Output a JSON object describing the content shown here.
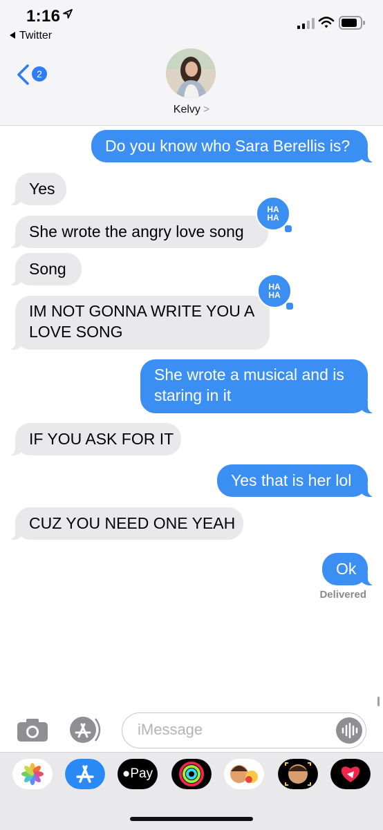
{
  "status_bar": {
    "time": "1:16",
    "back_app": "Twitter"
  },
  "header": {
    "unread_count": "2",
    "contact_name": "Kelvy",
    "chevron": ">"
  },
  "messages": [
    {
      "from": "me",
      "text": "Do you know who Sara Berellis is?"
    },
    {
      "from": "them",
      "text": "Yes"
    },
    {
      "from": "them",
      "text": "She wrote the angry love song",
      "reaction": "HA HA"
    },
    {
      "from": "them",
      "text": "Song"
    },
    {
      "from": "them",
      "text": "IM NOT GONNA WRITE YOU A LOVE SONG",
      "reaction": "HA HA"
    },
    {
      "from": "me",
      "text": "She wrote a musical and is staring in it"
    },
    {
      "from": "them",
      "text": "IF YOU ASK FOR IT"
    },
    {
      "from": "me",
      "text": "Yes that is her lol"
    },
    {
      "from": "them",
      "text": "CUZ YOU NEED ONE YEAH"
    },
    {
      "from": "me",
      "text": "Ok"
    }
  ],
  "reaction_label": {
    "line1": "HA",
    "line2": "HA"
  },
  "delivery_status": "Delivered",
  "input": {
    "placeholder": "iMessage"
  },
  "app_drawer": {
    "items": [
      "photos-app",
      "app-store-app",
      "apple-pay-app",
      "activity-app",
      "memoji-stickers-app",
      "animoji-app",
      "digital-touch-app"
    ],
    "apple_pay_label": "Pay"
  },
  "colors": {
    "blue": "#3b8ef2",
    "gray_bubble": "#e9e9eb",
    "header_bg": "#f5f5f7"
  }
}
